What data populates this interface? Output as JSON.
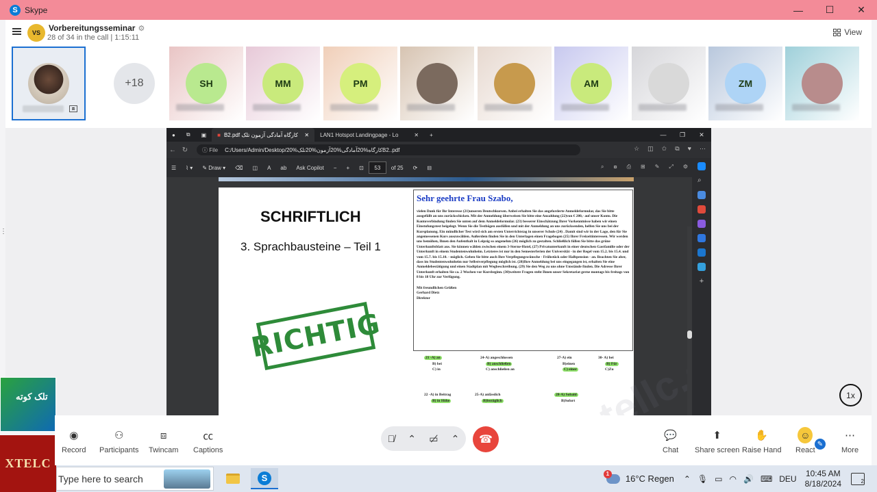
{
  "window": {
    "app_name": "Skype"
  },
  "call": {
    "group_name": "Vorbereitungsseminar",
    "group_avatar_text": "VS",
    "status": "28 of 34 in the call | 1:15:11",
    "view_label": "View",
    "overflow_count": "+18"
  },
  "participants": [
    {
      "initials": "SH",
      "bg": "#b9e98f",
      "tile_bg": "#e9c5c5"
    },
    {
      "initials": "MM",
      "bg": "#c9ea7c",
      "tile_bg": "#e7c9d8"
    },
    {
      "initials": "PM",
      "bg": "#d6ef7d",
      "tile_bg": "#f0cfb9"
    },
    {
      "initials": "",
      "bg": "#7b6a5e",
      "tile_bg": "#d7c4b2"
    },
    {
      "initials": "",
      "bg": "#c79a4d",
      "tile_bg": "#e7d9d0"
    },
    {
      "initials": "AM",
      "bg": "#c9ea7c",
      "tile_bg": "#c8c9ef"
    },
    {
      "initials": "",
      "bg": "#d9d9d9",
      "tile_bg": "#d6d6da"
    },
    {
      "initials": "ZM",
      "bg": "#aed4f6",
      "tile_bg": "#b9c8dd"
    },
    {
      "initials": "",
      "bg": "#b88c8c",
      "tile_bg": "#9fd0da"
    }
  ],
  "browser": {
    "tab1": "B2.pdf  کارگاه آمادگی آزمون تلک",
    "tab2": "LAN1 Hotspot Landingpage - Lo",
    "file_chip": "File",
    "url": "C:/Users/Admin/Desktop/کارگاه%20آمادگی%20آزمون%20تلک%20B2..pdf",
    "draw_label": "Draw",
    "ask_copilot": "Ask Copilot",
    "page_num": "53",
    "page_total": "of 25"
  },
  "pdf": {
    "title": "SCHRIFTLICH",
    "subtitle": "3.  Sprachbausteine – Teil 1",
    "stamp": "RICHTIG",
    "letter_heading": "Sehr geehrte Frau Szabo,",
    "letter_body": "vielen Dank für Ihr Interesse (21)unseren Deutschkursen. Anbei erhalten Sie das angeforderte Anmeldeformular, das Sie bitte ausgefüllt an uns zurückschicken. Mit der Anmeldung überweisen Sie bitte eine Anzahlung (22)von € 200,- auf unser Konto. Die Kontoverbindung finden Sie unten auf dem Anmeldeformular. (23) besserer Einschätzung Ihrer Vorkenntnisse haben wir einen Einstufungstest beigelegt. Wenn Sie die Testbögen ausfüllen und mit der Anmeldung an uns zurücksenden, helfen Sie uns bei der Kursplanung. Ein mündlicher Test wird sich am ersten Unterrichtstag in unserer Schule (24) . Damit sind wir in der Lage, den für Sie angemessenen Kurs auszuwählen. Außerdem finden Sie in den Unterlagen einen Fragebogen (25) Ihrer Freizeitinteressen. Wir werden uns bemühen, Ihnen den Aufenthalt in Leipzig so angenehm (26) möglich zu gestalten. Schließlich füllen Sie bitte das grüne Unterkunftsblatt aus. Sie können wählen zwischen einem 3-Sterne-Hotel, (27) Privatunterkunft in einer deutschen Gastfamilie oder der Unterkunft in einem Studentenwohnheim. Letzteres ist nur in den Semesterferien der Universität - in der Regel vom 15.2. bis 15.4. und vom 15.7. bis 15.10. - möglich. Geben Sie bitte auch Ihre Verpflegungswünsche - Frühstück oder Halbpension - an. Beachten Sie aber, dass im Studentenwohnheim nur Selbstverpflegung möglich ist. (28)Ihre Anmeldung bei uns eingegangen ist, erhalten Sie eine Anmeldebestätigung und einen Stadtplan mit Wegbeschreibung. (29) Sie den Weg zu uns ohne Umstände finden. Die Adresse Ihrer Unterkunft erhalten Sie ca. 2 Wochen vor Kursbeginn. (30)weitere Fragen steht Ihnen unser Sekretariat gerne montags bis freitags von 8 bis 18 Uhr zur Verfügung.",
    "closing_1": "Mit freundlichen Grüßen",
    "closing_2": "Gerhard Dietz",
    "closing_3": "Direktor",
    "answers": {
      "q21": [
        "21 -A) an",
        "B) bei",
        "C) in"
      ],
      "q24": [
        "24-A) angeschlossen",
        "B) anschließen",
        "C) anschließen an"
      ],
      "q27": [
        "27-A) ein",
        "B)einen",
        "C) einer"
      ],
      "q30": [
        "30- A) bei",
        "B) Für",
        "C)Zu"
      ],
      "q22": [
        "22 -A) in Beitrag",
        "B) in Höhe"
      ],
      "q25": [
        "25-A) anlässlich",
        "B)bezüglich"
      ],
      "q28": [
        "28-A) Sobald",
        "B)Sofort"
      ]
    },
    "watermark": "www.tellc.com"
  },
  "speed": "1x",
  "toolbar": {
    "record": "Record",
    "participants": "Participants",
    "twincam": "Twincam",
    "captions": "Captions",
    "chat": "Chat",
    "share_screen": "Share screen",
    "raise_hand": "Raise Hand",
    "react": "React",
    "more": "More"
  },
  "side_logo": "XTELC",
  "side_ad": "تلک کوته",
  "taskbar": {
    "search_placeholder": "Type here to search",
    "weather": "16°C  Regen",
    "weather_badge": "1",
    "lang": "DEU",
    "time": "10:45 AM",
    "date": "8/18/2024",
    "notif_count": "2"
  }
}
